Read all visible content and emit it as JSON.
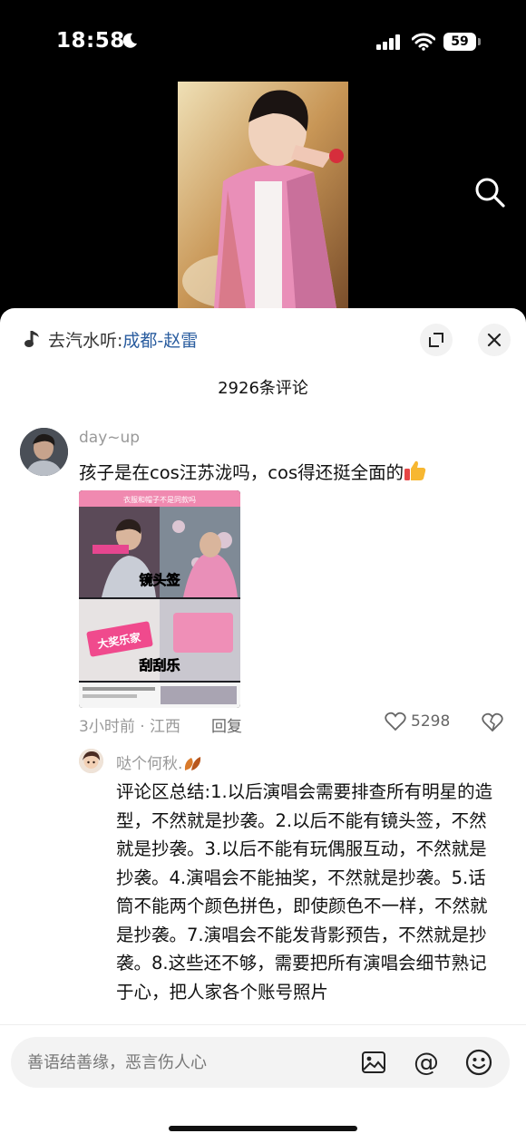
{
  "status_bar": {
    "time": "18:58",
    "battery": "59"
  },
  "sheet": {
    "source_prefix": "去汽水听:",
    "source_link": "成都-赵雷",
    "comment_count": "2926条评论"
  },
  "comments": [
    {
      "username": "day~up",
      "text": "孩子是在cos汪苏泷吗，cos得还挺全面的",
      "meta": "3小时前 · 江西",
      "reply_label": "回复",
      "likes": "5298",
      "image_captions": [
        "衣服和帽子不是同款吗",
        "镜头签",
        "大奖乐家",
        "刮刮乐"
      ]
    }
  ],
  "reply": {
    "username": "哒个何秋.",
    "text": "评论区总结:1.以后演唱会需要排查所有明星的造型，不然就是抄袭。2.以后不能有镜头签，不然就是抄袭。3.以后不能有玩偶服互动，不然就是抄袭。4.演唱会不能抽奖，不然就是抄袭。5.话筒不能两个颜色拼色，即使颜色不一样，不然就是抄袭。7.演唱会不能发背影预告，不然就是抄袭。8.这些还不够，需要把所有演唱会细节熟记于心，把人家各个账号照片"
  },
  "input": {
    "placeholder": "善语结善缘，恶言伤人心",
    "at_symbol": "@"
  },
  "colors": {
    "link": "#2a5d9f",
    "muted": "#999999",
    "sheet_bg": "#ffffff"
  }
}
